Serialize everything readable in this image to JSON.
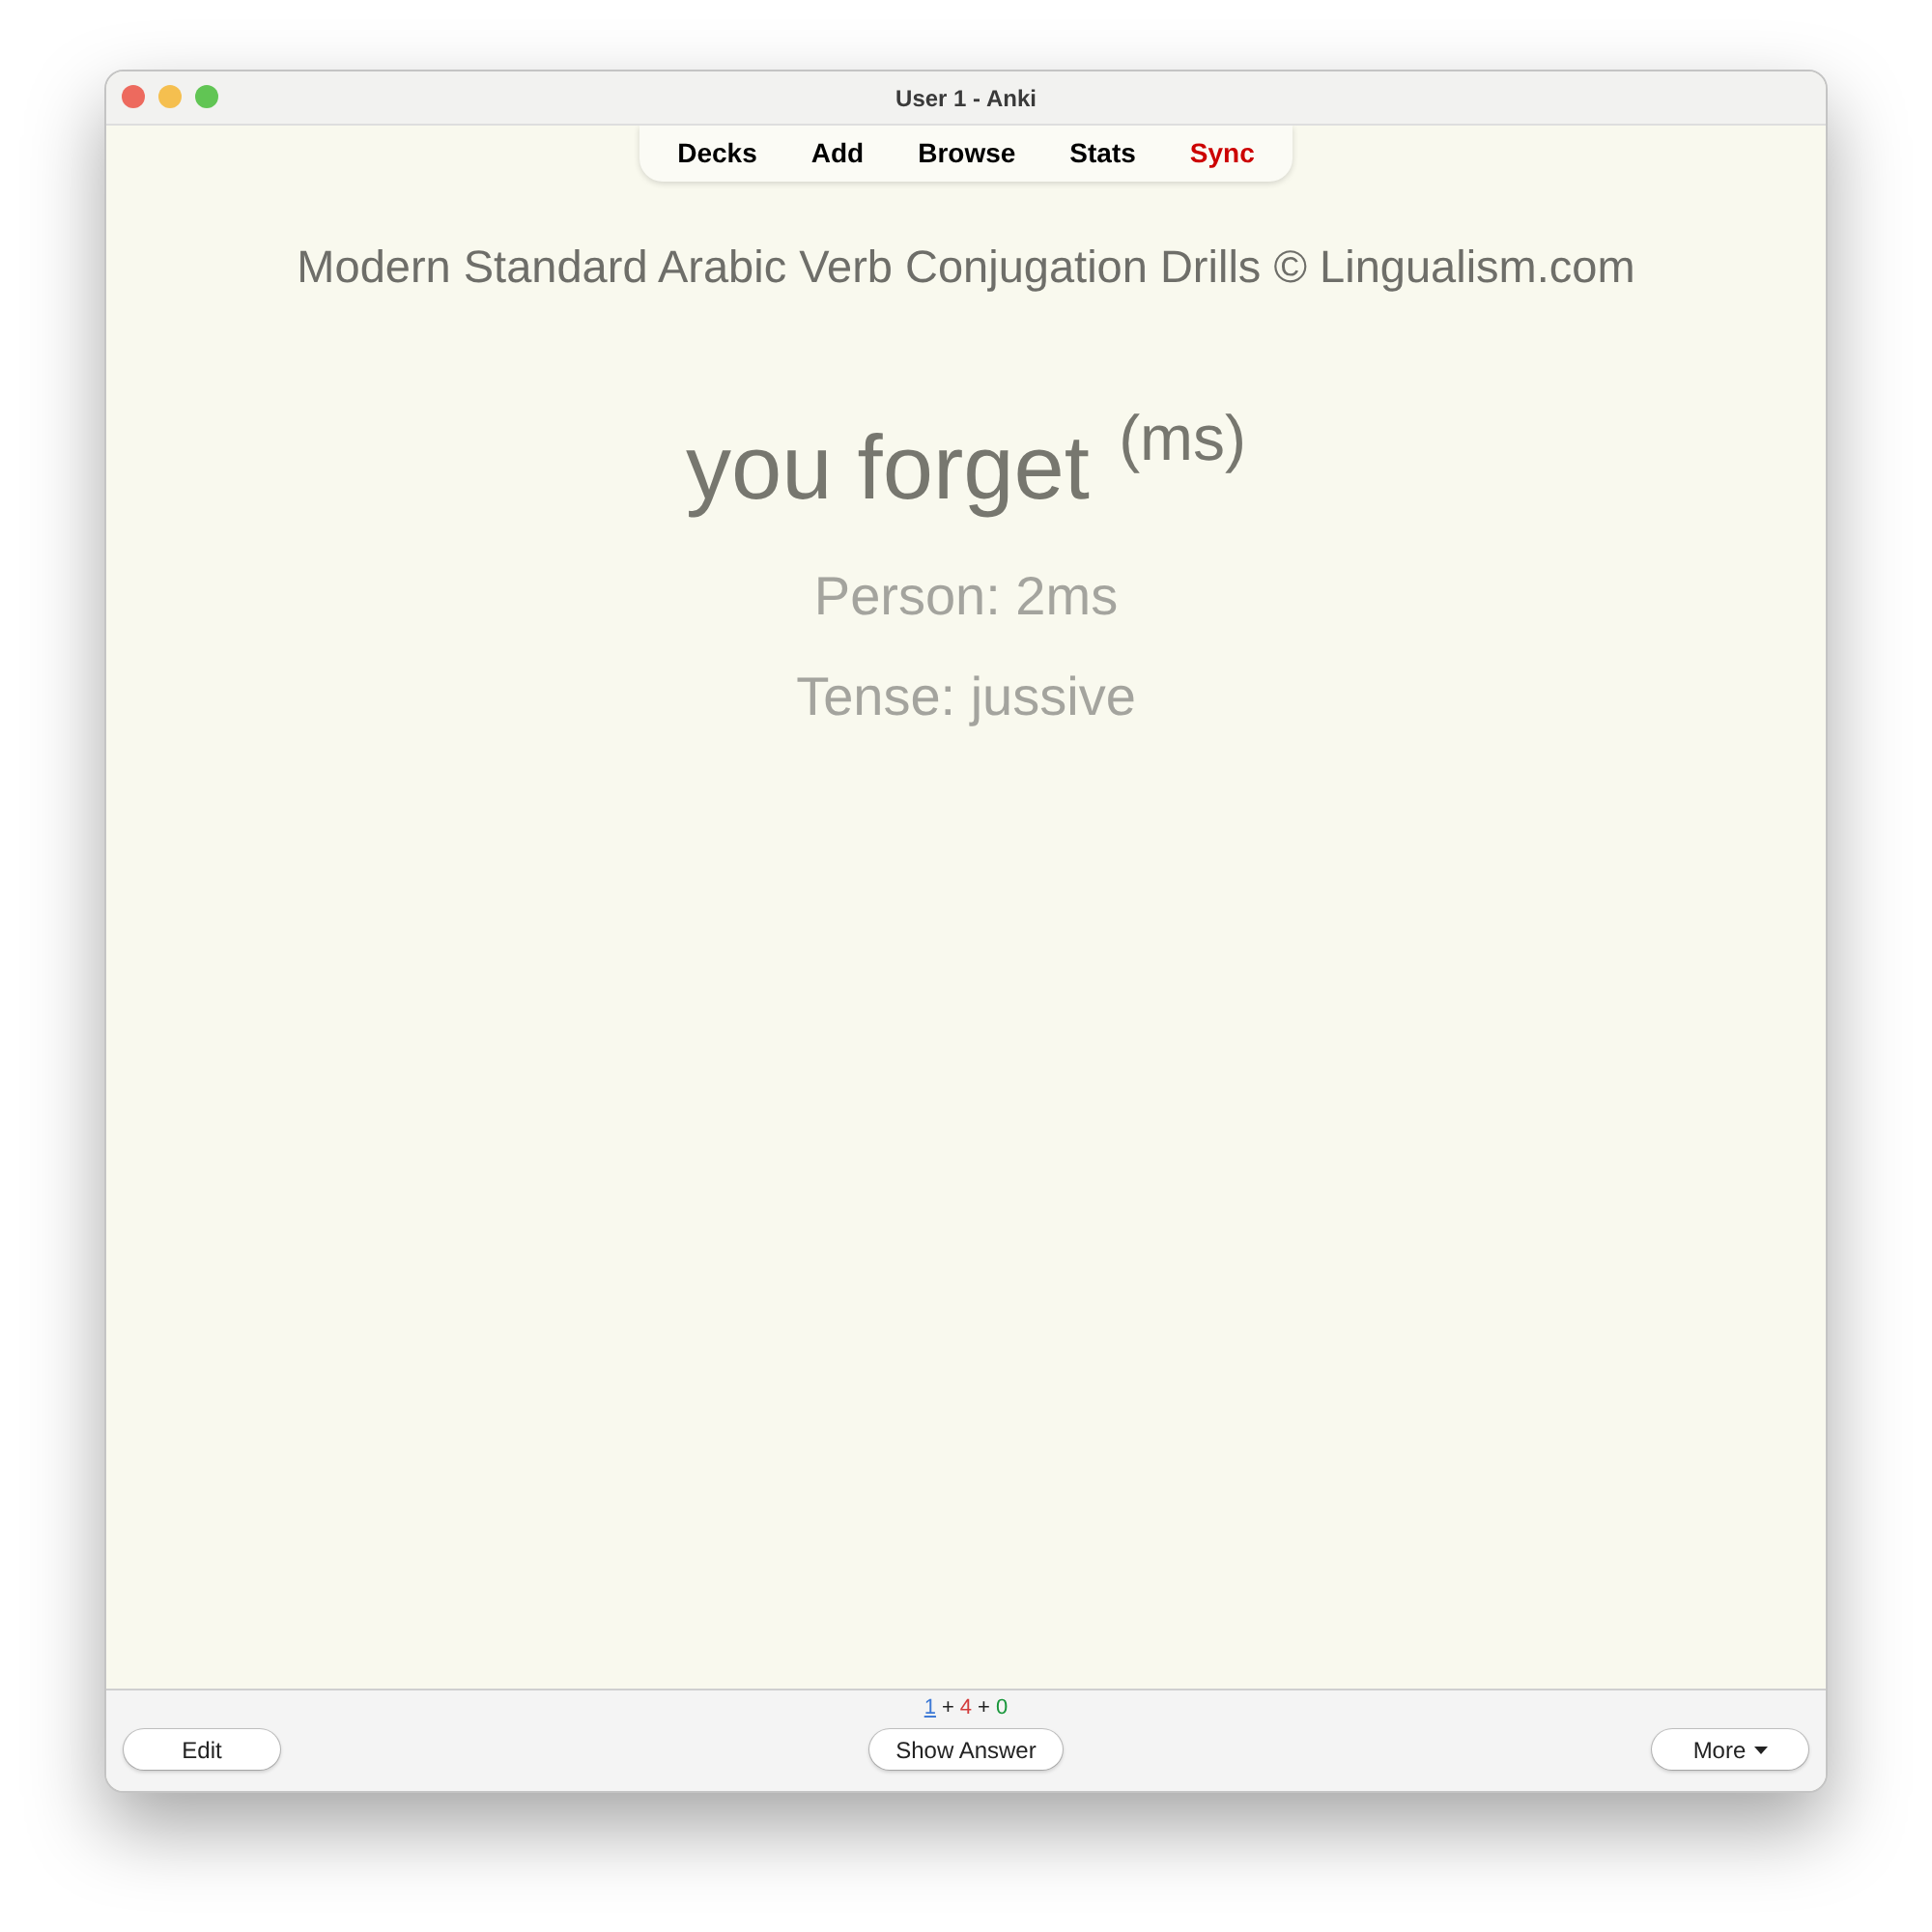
{
  "window": {
    "title": "User 1 - Anki"
  },
  "toolbar": {
    "items": [
      {
        "label": "Decks",
        "alert": false
      },
      {
        "label": "Add",
        "alert": false
      },
      {
        "label": "Browse",
        "alert": false
      },
      {
        "label": "Stats",
        "alert": false
      },
      {
        "label": "Sync",
        "alert": true
      }
    ]
  },
  "card": {
    "header": "Modern Standard Arabic Verb Conjugation Drills © Lingualism.com",
    "prompt": "you forget $^{(ms)}$",
    "details": [
      "Person: 2ms",
      "Tense: jussive"
    ]
  },
  "bottom_bar": {
    "queue_counts": [
      {
        "kind": "count",
        "text": "1",
        "color": "#3f7ad6",
        "active": true
      },
      {
        "kind": "separator",
        "text": "+"
      },
      {
        "kind": "count",
        "text": "4",
        "color": "#d33b3b",
        "active": false
      },
      {
        "kind": "separator",
        "text": "+"
      },
      {
        "kind": "count",
        "text": "0",
        "color": "#18963a",
        "active": false
      }
    ],
    "edit_button": {
      "label": "Edit"
    },
    "show_answer_button": {
      "label": "Show Answer"
    },
    "more_button": {
      "label": "More",
      "dropdown": true
    }
  }
}
